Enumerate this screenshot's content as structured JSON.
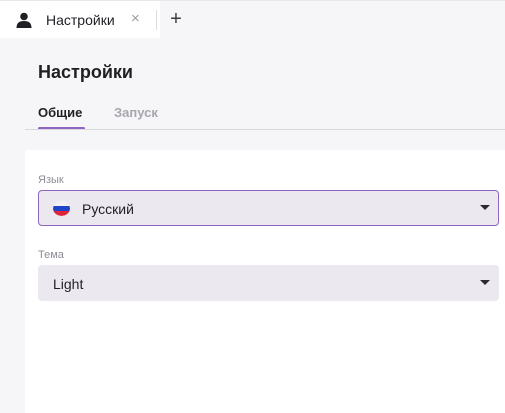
{
  "tabs": {
    "active_tab": {
      "label": "Настройки",
      "icon": "user-icon",
      "close_glyph": "×"
    },
    "add_tab_glyph": "+"
  },
  "settings": {
    "title": "Настройки",
    "subtabs": [
      {
        "label": "Общие",
        "active": true
      },
      {
        "label": "Запуск",
        "active": false
      }
    ],
    "language": {
      "label": "Язык",
      "value": "Русский",
      "flag": "russia-flag-icon"
    },
    "theme": {
      "label": "Тема",
      "value": "Light"
    }
  },
  "colors": {
    "accent": "#8c66c0",
    "select_background": "#ebe9ef",
    "page_background": "#f6f6f8"
  }
}
